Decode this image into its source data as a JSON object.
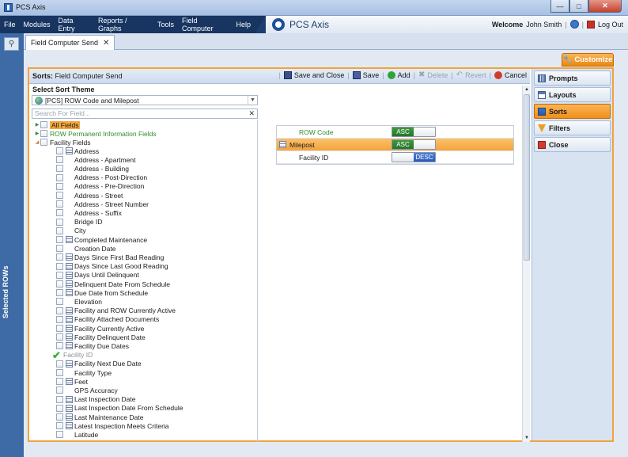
{
  "window": {
    "title": "PCS Axis"
  },
  "menu": {
    "items": [
      "File",
      "Modules",
      "Data Entry",
      "Reports / Graphs",
      "Tools",
      "Field Computer",
      "Help"
    ],
    "brand": "PCS Axis",
    "welcome_label": "Welcome",
    "user_name": "John Smith",
    "logout_label": "Log Out"
  },
  "left_rail": {
    "label": "Selected ROWs"
  },
  "doc_tab": {
    "label": "Field Computer Send"
  },
  "customize_label": "Customize",
  "sorts_header": {
    "prefix": "Sorts:",
    "name": "Field Computer Send"
  },
  "toolbar": {
    "save_close": "Save and Close",
    "save": "Save",
    "add": "Add",
    "delete": "Delete",
    "revert": "Revert",
    "cancel": "Cancel"
  },
  "theme": {
    "heading": "Select Sort Theme",
    "selected": "[PCS] ROW Code and Milepost"
  },
  "field_search": {
    "placeholder": "Search For Field..."
  },
  "tree": {
    "all_fields": "All Fields",
    "row_info": "ROW Permanent Information Fields",
    "facility_fields": "Facility Fields",
    "items": [
      {
        "label": "Address",
        "icon": true
      },
      {
        "label": "Address - Apartment",
        "icon": false
      },
      {
        "label": "Address - Building",
        "icon": false
      },
      {
        "label": "Address - Post-Direction",
        "icon": false
      },
      {
        "label": "Address - Pre-Direction",
        "icon": false
      },
      {
        "label": "Address - Street",
        "icon": false
      },
      {
        "label": "Address - Street Number",
        "icon": false
      },
      {
        "label": "Address - Suffix",
        "icon": false
      },
      {
        "label": "Bridge ID",
        "icon": false
      },
      {
        "label": "City",
        "icon": false
      },
      {
        "label": "Completed Maintenance",
        "icon": true
      },
      {
        "label": "Creation Date",
        "icon": false
      },
      {
        "label": "Days Since First Bad Reading",
        "icon": true
      },
      {
        "label": "Days Since Last Good Reading",
        "icon": true
      },
      {
        "label": "Days Until Delinquent",
        "icon": true
      },
      {
        "label": "Delinquent Date From Schedule",
        "icon": true
      },
      {
        "label": "Due Date from Schedule",
        "icon": true
      },
      {
        "label": "Elevation",
        "icon": false
      },
      {
        "label": "Facility and ROW Currently Active",
        "icon": true
      },
      {
        "label": "Facility Attached Documents",
        "icon": true
      },
      {
        "label": "Facility Currently Active",
        "icon": true
      },
      {
        "label": "Facility Delinquent Date",
        "icon": true
      },
      {
        "label": "Facility Due Dates",
        "icon": true
      },
      {
        "label": "Facility ID",
        "icon": false,
        "checked": true
      },
      {
        "label": "Facility Next Due Date",
        "icon": true
      },
      {
        "label": "Facility Type",
        "icon": false
      },
      {
        "label": "Feet",
        "icon": true
      },
      {
        "label": "GPS Accuracy",
        "icon": false
      },
      {
        "label": "Last Inspection Date",
        "icon": true
      },
      {
        "label": "Last Inspection Date From Schedule",
        "icon": true
      },
      {
        "label": "Last Maintenance Date",
        "icon": true
      },
      {
        "label": "Latest Inspection Meets Criteria",
        "icon": true
      },
      {
        "label": "Latitude",
        "icon": false
      }
    ]
  },
  "sort_rows": [
    {
      "name": "ROW Code",
      "order": "ASC"
    },
    {
      "name": "Milepost",
      "order": "ASC"
    },
    {
      "name": "Facility ID",
      "order": "DESC"
    }
  ],
  "side_panel": {
    "prompts": "Prompts",
    "layouts": "Layouts",
    "sorts": "Sorts",
    "filters": "Filters",
    "close": "Close"
  },
  "colors": {
    "accent_orange": "#f4a23c",
    "menu_navy": "#1d3f6e",
    "asc_green": "#2d8a33",
    "desc_blue": "#3a6fd0"
  }
}
